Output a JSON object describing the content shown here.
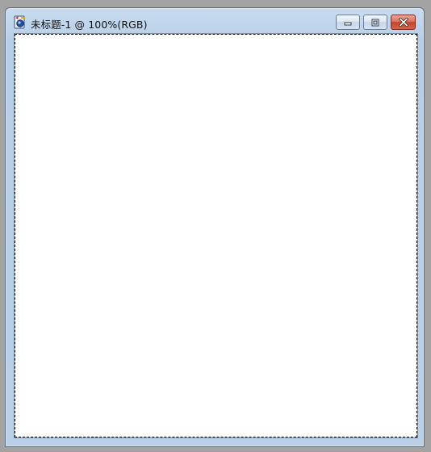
{
  "window": {
    "title": "未标题-1 @ 100%(RGB)",
    "app_icon": "photoshop-document-icon"
  },
  "controls": {
    "minimize_icon": "minimize-icon",
    "maximize_icon": "maximize-icon",
    "close_icon": "close-icon"
  },
  "canvas": {
    "background": "#ffffff",
    "selection": "marquee-selection"
  },
  "colors": {
    "desktop": "#a3a3a3",
    "titlebar": "#bcd3ea",
    "close_button": "#c2452c"
  }
}
